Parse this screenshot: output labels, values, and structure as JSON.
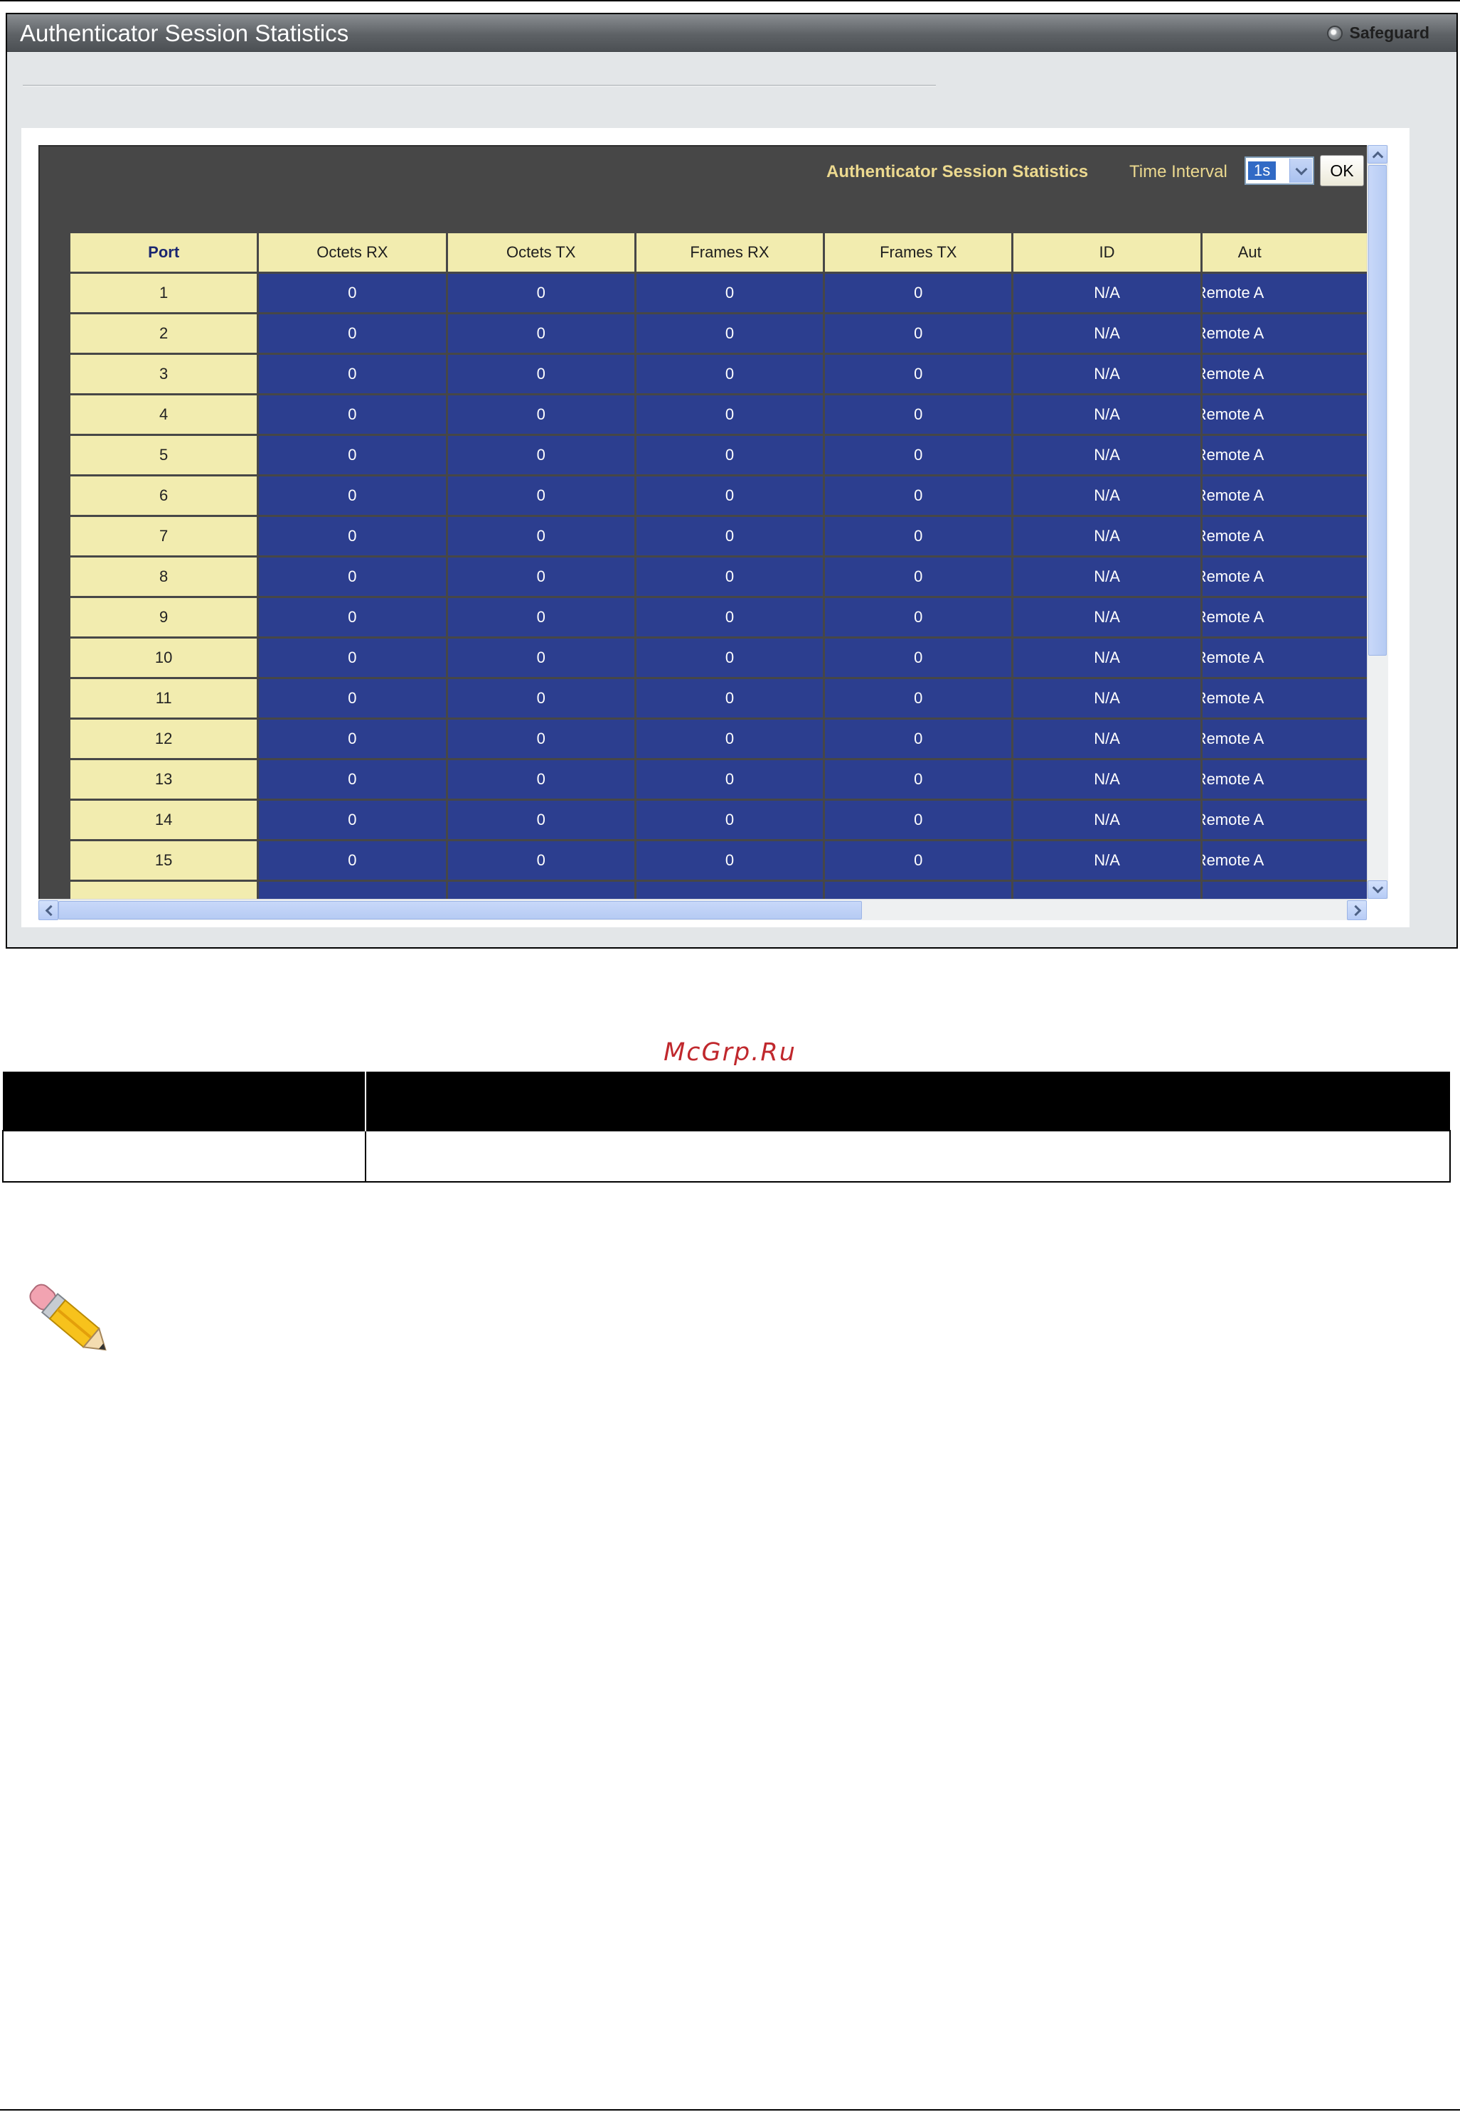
{
  "window": {
    "title": "Authenticator Session Statistics",
    "badge": "Safeguard"
  },
  "controls": {
    "panel_label": "Authenticator Session Statistics",
    "interval_label": "Time Interval",
    "interval_value": "1s",
    "ok_label": "OK"
  },
  "table": {
    "columns": [
      "Port",
      "Octets RX",
      "Octets TX",
      "Frames RX",
      "Frames TX",
      "ID",
      "Aut"
    ],
    "rows": [
      [
        "1",
        "0",
        "0",
        "0",
        "0",
        "N/A",
        "Remote A"
      ],
      [
        "2",
        "0",
        "0",
        "0",
        "0",
        "N/A",
        "Remote A"
      ],
      [
        "3",
        "0",
        "0",
        "0",
        "0",
        "N/A",
        "Remote A"
      ],
      [
        "4",
        "0",
        "0",
        "0",
        "0",
        "N/A",
        "Remote A"
      ],
      [
        "5",
        "0",
        "0",
        "0",
        "0",
        "N/A",
        "Remote A"
      ],
      [
        "6",
        "0",
        "0",
        "0",
        "0",
        "N/A",
        "Remote A"
      ],
      [
        "7",
        "0",
        "0",
        "0",
        "0",
        "N/A",
        "Remote A"
      ],
      [
        "8",
        "0",
        "0",
        "0",
        "0",
        "N/A",
        "Remote A"
      ],
      [
        "9",
        "0",
        "0",
        "0",
        "0",
        "N/A",
        "Remote A"
      ],
      [
        "10",
        "0",
        "0",
        "0",
        "0",
        "N/A",
        "Remote A"
      ],
      [
        "11",
        "0",
        "0",
        "0",
        "0",
        "N/A",
        "Remote A"
      ],
      [
        "12",
        "0",
        "0",
        "0",
        "0",
        "N/A",
        "Remote A"
      ],
      [
        "13",
        "0",
        "0",
        "0",
        "0",
        "N/A",
        "Remote A"
      ],
      [
        "14",
        "0",
        "0",
        "0",
        "0",
        "N/A",
        "Remote A"
      ],
      [
        "15",
        "0",
        "0",
        "0",
        "0",
        "N/A",
        "Remote A"
      ],
      [
        "",
        "",
        "",
        "",
        "",
        "",
        ""
      ]
    ]
  },
  "watermark": "McGrp.Ru",
  "colors": {
    "title_bar": "#5e6266",
    "panel": "#474747",
    "header_cell": "#f2ecaf",
    "data_cell": "#2c3e8f",
    "label_text": "#ecd98f",
    "watermark": "#c0282d"
  }
}
